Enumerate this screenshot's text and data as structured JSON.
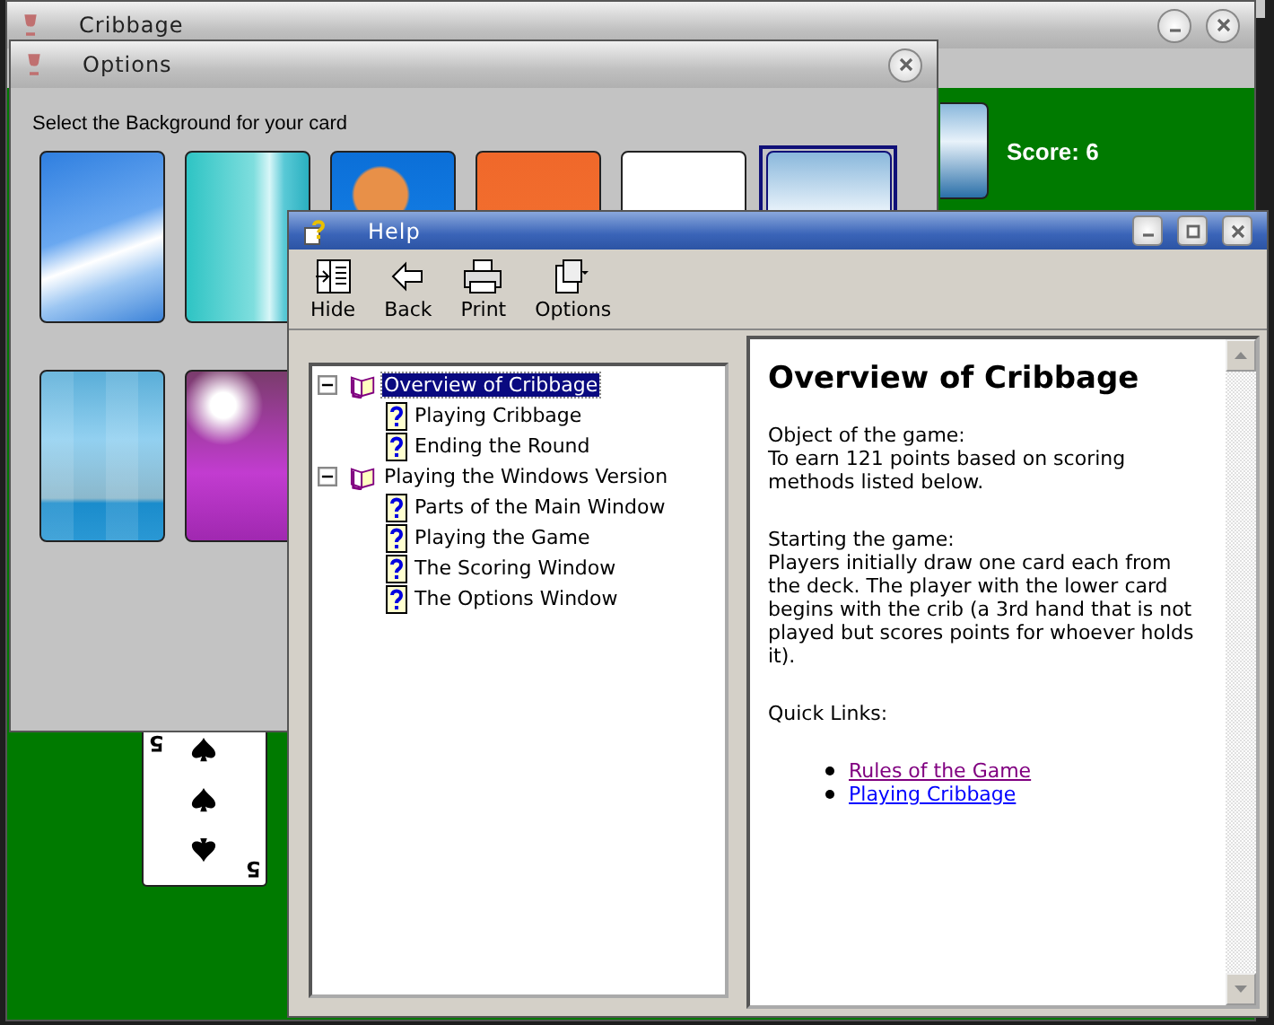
{
  "main_window": {
    "title": "Cribbage",
    "score": "Score: 6",
    "card": {
      "corners": [
        "5",
        "5"
      ]
    }
  },
  "options_window": {
    "title": "Options",
    "prompt": "Select the Background for your card",
    "card_backs": [
      {
        "kind": "clouds",
        "selected": false
      },
      {
        "kind": "teal",
        "selected": false
      },
      {
        "kind": "fish",
        "selected": false
      },
      {
        "kind": "orange",
        "selected": false
      },
      {
        "kind": "pink",
        "selected": false
      },
      {
        "kind": "beach",
        "selected": true
      },
      {
        "kind": "tiles",
        "selected": false
      },
      {
        "kind": "lights",
        "selected": false
      }
    ]
  },
  "help_window": {
    "title": "Help",
    "toolbar": [
      {
        "kind": "hide",
        "label": "Hide"
      },
      {
        "kind": "back",
        "label": "Back"
      },
      {
        "kind": "print",
        "label": "Print"
      },
      {
        "kind": "options",
        "label": "Options"
      }
    ],
    "contents": [
      {
        "label": "Overview of Cribbage",
        "expanded": true,
        "selected": true,
        "children": [
          {
            "label": "Playing Cribbage",
            "selected": false
          },
          {
            "label": "Ending the Round",
            "selected": false
          }
        ]
      },
      {
        "label": "Playing the Windows Version",
        "expanded": true,
        "selected": false,
        "children": [
          {
            "label": "Parts of the Main Window",
            "selected": false
          },
          {
            "label": "Playing the Game",
            "selected": false
          },
          {
            "label": "The Scoring Window",
            "selected": false
          },
          {
            "label": "The Options Window",
            "selected": false
          }
        ]
      }
    ],
    "topic": {
      "heading": "Overview of Cribbage",
      "sections": [
        {
          "label": "Object of the game:",
          "text": "To earn 121 points based on scoring methods listed below."
        },
        {
          "label": "Starting the game:",
          "text": "Players initially draw one card each from the deck. The player with the lower card begins with the crib (a 3rd hand that is not played but scores points for whoever holds it)."
        }
      ],
      "quick_links_label": "Quick Links:",
      "links": [
        {
          "label": "Rules of the Game",
          "visited": true
        },
        {
          "label": "Playing Cribbage",
          "visited": false
        }
      ]
    }
  }
}
